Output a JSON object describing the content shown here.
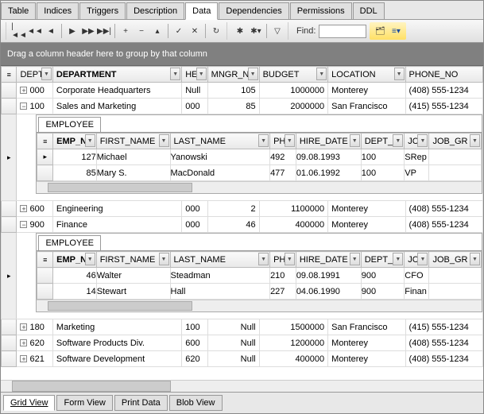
{
  "tabs": {
    "items": [
      "Table",
      "Indices",
      "Triggers",
      "Description",
      "Data",
      "Dependencies",
      "Permissions",
      "DDL"
    ],
    "activeIndex": 4
  },
  "toolbar": {
    "findLabel": "Find:",
    "findValue": ""
  },
  "groupbar": {
    "text": "Drag a column header here to group by that column"
  },
  "columns": {
    "dept": "DEPT",
    "department": "DEPARTMENT",
    "head": "HE",
    "mngr": "MNGR_N",
    "budget": "BUDGET",
    "location": "LOCATION",
    "phone": "PHONE_NO"
  },
  "rows": [
    {
      "exp": "⊞",
      "dept": "000",
      "department": "Corporate Headquarters",
      "head": "Null",
      "mngr": "105",
      "budget": "1000000",
      "location": "Monterey",
      "phone": "(408) 555-1234"
    },
    {
      "exp": "⊟",
      "dept": "100",
      "department": "Sales and Marketing",
      "head": "000",
      "mngr": "85",
      "budget": "2000000",
      "location": "San Francisco",
      "phone": "(415) 555-1234",
      "nestedIndex": 0
    },
    {
      "exp": "⊞",
      "dept": "600",
      "department": "Engineering",
      "head": "000",
      "mngr": "2",
      "budget": "1100000",
      "location": "Monterey",
      "phone": "(408) 555-1234"
    },
    {
      "exp": "⊟",
      "dept": "900",
      "department": "Finance",
      "head": "000",
      "mngr": "46",
      "budget": "400000",
      "location": "Monterey",
      "phone": "(408) 555-1234",
      "nestedIndex": 1
    },
    {
      "exp": "⊞",
      "dept": "180",
      "department": "Marketing",
      "head": "100",
      "mngr": "Null",
      "budget": "1500000",
      "location": "San Francisco",
      "phone": "(415) 555-1234"
    },
    {
      "exp": "⊞",
      "dept": "620",
      "department": "Software Products Div.",
      "head": "600",
      "mngr": "Null",
      "budget": "1200000",
      "location": "Monterey",
      "phone": "(408) 555-1234"
    },
    {
      "exp": "⊞",
      "dept": "621",
      "department": "Software Development",
      "head": "620",
      "mngr": "Null",
      "budget": "400000",
      "location": "Monterey",
      "phone": "(408) 555-1234"
    }
  ],
  "nested": {
    "tabLabel": "EMPLOYEE",
    "columns": {
      "emp": "EMP_N",
      "first": "FIRST_NAME",
      "last": "LAST_NAME",
      "ph": "PH",
      "hire": "HIRE_DATE",
      "dept": "DEPT_",
      "jc": "JC",
      "jobgr": "JOB_GR"
    },
    "sets": [
      {
        "rows": [
          {
            "sel": "▸",
            "emp": "127",
            "first": "Michael",
            "last": "Yanowski",
            "ph": "492",
            "hire": "09.08.1993",
            "dept": "100",
            "jc": "SRep",
            "jobgr": ""
          },
          {
            "sel": "",
            "emp": "85",
            "first": "Mary S.",
            "last": "MacDonald",
            "ph": "477",
            "hire": "01.06.1992",
            "dept": "100",
            "jc": "VP",
            "jobgr": ""
          }
        ]
      },
      {
        "rows": [
          {
            "sel": "",
            "emp": "46",
            "first": "Walter",
            "last": "Steadman",
            "ph": "210",
            "hire": "09.08.1991",
            "dept": "900",
            "jc": "CFO",
            "jobgr": ""
          },
          {
            "sel": "",
            "emp": "14",
            "first": "Stewart",
            "last": "Hall",
            "ph": "227",
            "hire": "04.06.1990",
            "dept": "900",
            "jc": "Finan",
            "jobgr": ""
          }
        ]
      }
    ]
  },
  "bottomTabs": {
    "items": [
      "Grid View",
      "Form View",
      "Print Data",
      "Blob View"
    ],
    "activeIndex": 0
  }
}
